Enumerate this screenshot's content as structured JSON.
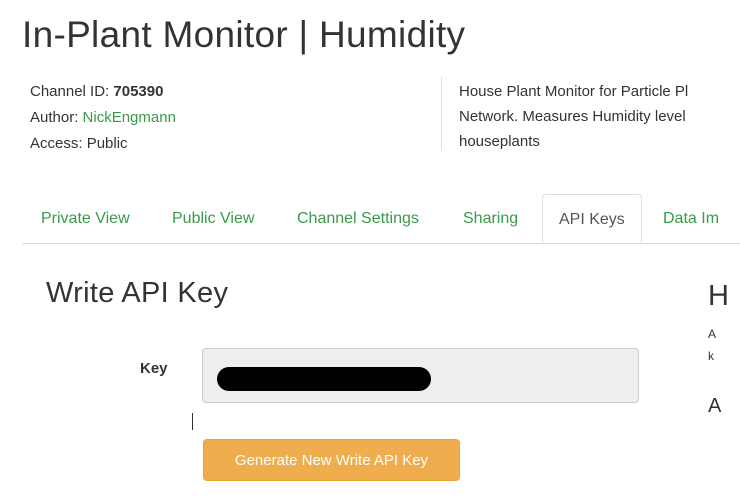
{
  "header": {
    "title": "In-Plant Monitor | Humidity"
  },
  "channel": {
    "id_label": "Channel ID:",
    "id_value": "705390",
    "author_label": "Author:",
    "author_value": "NickEngmann",
    "access_label": "Access:",
    "access_value": "Public",
    "description_lines": [
      "House Plant Monitor for Particle Pl",
      "Network. Measures Humidity level",
      "houseplants"
    ]
  },
  "tabs": [
    {
      "label": "Private View",
      "active": false
    },
    {
      "label": "Public View",
      "active": false
    },
    {
      "label": "Channel Settings",
      "active": false
    },
    {
      "label": "Sharing",
      "active": false
    },
    {
      "label": "API Keys",
      "active": true
    },
    {
      "label": "Data Im",
      "active": false
    }
  ],
  "write_key": {
    "section_title": "Write API Key",
    "key_label": "Key",
    "key_value": "",
    "generate_button": "Generate New Write API Key"
  },
  "right_panel": {
    "heading_fragment": "H",
    "line1_fragment": "A",
    "line2_fragment": "k",
    "subheading_fragment": "A"
  },
  "colors": {
    "link_green": "#3a9a4a",
    "button_orange": "#f0ad4e",
    "field_bg": "#eeeeee",
    "redaction": "#000000"
  }
}
